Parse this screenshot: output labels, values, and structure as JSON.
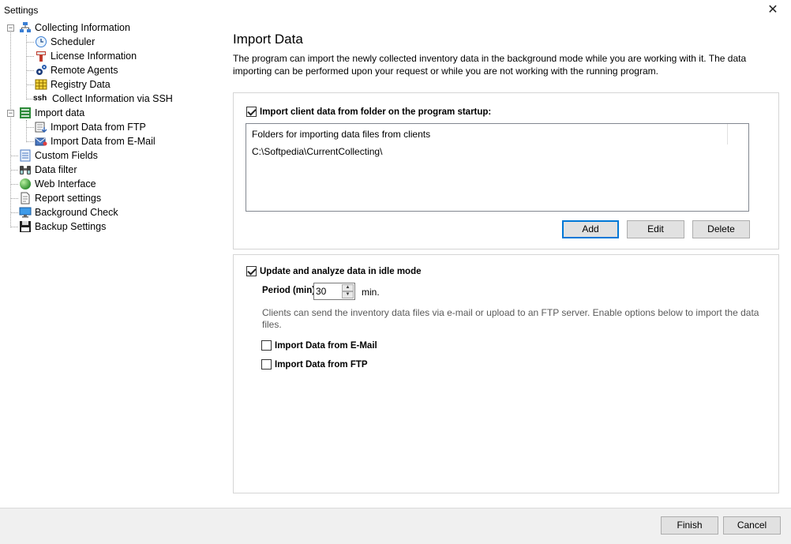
{
  "window": {
    "title": "Settings",
    "close_glyph": "✕"
  },
  "tree": {
    "items": [
      {
        "label": "Collecting Information",
        "icon": "network-icon"
      },
      {
        "label": "Scheduler",
        "icon": "clock-icon"
      },
      {
        "label": "License Information",
        "icon": "license-icon"
      },
      {
        "label": "Remote Agents",
        "icon": "gears-icon"
      },
      {
        "label": "Registry Data",
        "icon": "grid-icon"
      },
      {
        "label": "Collect Information via SSH",
        "icon": "ssh-icon",
        "icon_text": "ssh"
      },
      {
        "label": "Import data",
        "icon": "import-icon"
      },
      {
        "label": "Import Data from FTP",
        "icon": "ftp-import-icon"
      },
      {
        "label": "Import Data from E-Mail",
        "icon": "email-import-icon"
      },
      {
        "label": "Custom Fields",
        "icon": "list-icon"
      },
      {
        "label": "Data filter",
        "icon": "binoculars-icon"
      },
      {
        "label": "Web Interface",
        "icon": "globe-icon"
      },
      {
        "label": "Report settings",
        "icon": "report-icon"
      },
      {
        "label": "Background Check",
        "icon": "monitor-icon"
      },
      {
        "label": "Backup Settings",
        "icon": "floppy-icon"
      }
    ],
    "expander_glyph": "−"
  },
  "page": {
    "title": "Import Data",
    "description": "The program can import the newly collected inventory data in the background mode while you are working with it. The data importing can be performed upon your request or while you are not working with the running program."
  },
  "folder_group": {
    "checkbox_label": "Import client data from folder on the program startup:",
    "checked": true,
    "list_header": "Folders for importing data files from clients",
    "folders": [
      "C:\\Softpedia\\CurrentCollecting\\"
    ],
    "add_label": "Add",
    "edit_label": "Edit",
    "delete_label": "Delete"
  },
  "idle_group": {
    "checkbox_label": "Update and analyze data in idle mode",
    "checked": true,
    "period_label": "Period (min)",
    "period_value": "30",
    "period_unit": "min.",
    "note": "Clients can send the inventory data files via e-mail or upload to an FTP server. Enable options below to import the data files.",
    "email_label": "Import Data from E-Mail",
    "email_checked": false,
    "ftp_label": "Import Data from FTP",
    "ftp_checked": false
  },
  "footer": {
    "finish_label": "Finish",
    "cancel_label": "Cancel"
  },
  "colors": {
    "accent": "#0078d7",
    "footer_bg": "#f0f0f0",
    "button_bg": "#e1e1e1"
  }
}
